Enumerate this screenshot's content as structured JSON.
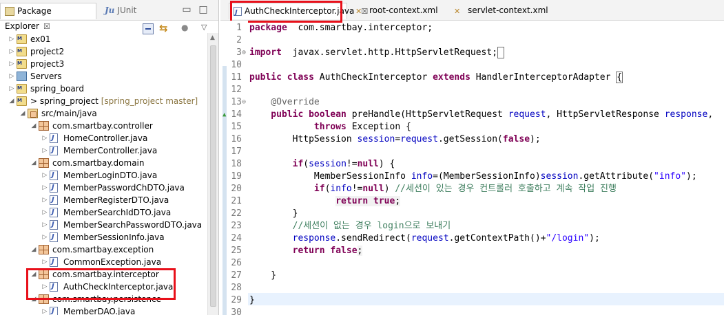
{
  "left_panel": {
    "tabs": [
      {
        "label": "Package Explorer",
        "close": "☒"
      },
      {
        "label": "JUnit",
        "icon_text": "Ju"
      }
    ],
    "tree": [
      {
        "label": "ex01",
        "suffix": "",
        "type": "project",
        "expanded": false
      },
      {
        "label": "project2",
        "suffix": "",
        "type": "project",
        "expanded": false
      },
      {
        "label": "project3",
        "suffix": "",
        "type": "project",
        "expanded": false
      },
      {
        "label": "Servers",
        "suffix": "",
        "type": "server-folder",
        "expanded": false
      },
      {
        "label": "spring_board",
        "suffix": "",
        "type": "project",
        "expanded": false
      },
      {
        "label": "> spring_project",
        "suffix": " [spring_project master]",
        "type": "project",
        "expanded": true
      },
      {
        "label": "src/main/java",
        "suffix": "",
        "type": "source-folder",
        "expanded": true
      },
      {
        "label": "com.smartbay.controller",
        "suffix": "",
        "type": "package",
        "expanded": true
      },
      {
        "label": "HomeController.java",
        "suffix": "",
        "type": "java-file",
        "expanded": false
      },
      {
        "label": "MemberController.java",
        "suffix": "",
        "type": "java-file",
        "expanded": false
      },
      {
        "label": "com.smartbay.domain",
        "suffix": "",
        "type": "package",
        "expanded": true
      },
      {
        "label": "MemberLoginDTO.java",
        "suffix": "",
        "type": "java-file",
        "expanded": false
      },
      {
        "label": "MemberPasswordChDTO.java",
        "suffix": "",
        "type": "java-file",
        "expanded": false
      },
      {
        "label": "MemberRegisterDTO.java",
        "suffix": "",
        "type": "java-file",
        "expanded": false
      },
      {
        "label": "MemberSearchIdDTO.java",
        "suffix": "",
        "type": "java-file",
        "expanded": false
      },
      {
        "label": "MemberSearchPasswordDTO.java",
        "suffix": "",
        "type": "java-file",
        "expanded": false
      },
      {
        "label": "MemberSessionInfo.java",
        "suffix": "",
        "type": "java-file",
        "expanded": false
      },
      {
        "label": "com.smartbay.exception",
        "suffix": "",
        "type": "package",
        "expanded": true
      },
      {
        "label": "CommonException.java",
        "suffix": "",
        "type": "java-file",
        "expanded": false
      },
      {
        "label": "com.smartbay.interceptor",
        "suffix": "",
        "type": "package",
        "expanded": true
      },
      {
        "label": "AuthCheckInterceptor.java",
        "suffix": "",
        "type": "java-file",
        "expanded": false
      },
      {
        "label": "com.smartbay.persistence",
        "suffix": "",
        "type": "package",
        "expanded": true
      },
      {
        "label": "MemberDAO.java",
        "suffix": "",
        "type": "java-file",
        "expanded": false
      }
    ]
  },
  "editor": {
    "tabs": [
      {
        "label": "AuthCheckInterceptor.java",
        "active": true,
        "close": "☒"
      },
      {
        "label": "root-context.xml",
        "active": false
      },
      {
        "label": "servlet-context.xml",
        "active": false
      }
    ],
    "lines": [
      {
        "n": "1",
        "parts": [
          [
            "kw",
            "package"
          ],
          [
            "",
            "  com.smartbay.interceptor;"
          ]
        ]
      },
      {
        "n": "2",
        "parts": []
      },
      {
        "n": "3⊕",
        "parts": [
          [
            "kw",
            "import"
          ],
          [
            "",
            "  javax.servlet.http.HttpServletRequest;"
          ],
          [
            "box",
            "⁠ ⁠"
          ]
        ]
      },
      {
        "n": "10",
        "parts": []
      },
      {
        "n": "11",
        "parts": [
          [
            "kw",
            "public class"
          ],
          [
            "",
            " AuthCheckInterceptor "
          ],
          [
            "kw",
            "extends"
          ],
          [
            "",
            " HandlerInterceptorAdapter "
          ],
          [
            "box",
            "{"
          ]
        ]
      },
      {
        "n": "12",
        "parts": []
      },
      {
        "n": "13⊖",
        "parts": [
          [
            "",
            ""
          ],
          [
            "ann",
            "    @Override"
          ]
        ]
      },
      {
        "n": "14",
        "parts": [
          [
            "kw",
            "    public boolean"
          ],
          [
            "",
            " preHandle(HttpServletRequest "
          ],
          [
            "fld",
            "request"
          ],
          [
            "",
            ", HttpServletResponse "
          ],
          [
            "fld",
            "response"
          ],
          [
            "",
            ","
          ]
        ]
      },
      {
        "n": "15",
        "parts": [
          [
            "",
            "            "
          ],
          [
            "kw",
            "throws"
          ],
          [
            "",
            " Exception {"
          ]
        ]
      },
      {
        "n": "16",
        "parts": [
          [
            "",
            "        HttpSession "
          ],
          [
            "fld",
            "session"
          ],
          [
            "",
            "="
          ],
          [
            "fld",
            "request"
          ],
          [
            "",
            ".getSession("
          ],
          [
            "kw",
            "false"
          ],
          [
            "",
            ");"
          ]
        ]
      },
      {
        "n": "17",
        "parts": []
      },
      {
        "n": "18",
        "parts": [
          [
            "kw",
            "        if"
          ],
          [
            "",
            "("
          ],
          [
            "fld",
            "session"
          ],
          [
            "",
            "!="
          ],
          [
            "kw",
            "null"
          ],
          [
            "",
            ") {"
          ]
        ]
      },
      {
        "n": "19",
        "parts": [
          [
            "",
            "            MemberSessionInfo "
          ],
          [
            "fld",
            "info"
          ],
          [
            "",
            "=(MemberSessionInfo)"
          ],
          [
            "fld",
            "session"
          ],
          [
            "",
            ".getAttribute("
          ],
          [
            "str",
            "\"info\""
          ],
          [
            "",
            ");"
          ]
        ]
      },
      {
        "n": "20",
        "parts": [
          [
            "kw",
            "            if"
          ],
          [
            "",
            "("
          ],
          [
            "fld",
            "info"
          ],
          [
            "",
            "!="
          ],
          [
            "kw",
            "null"
          ],
          [
            "",
            ") "
          ],
          [
            "cm",
            "//세션이 있는 경우 컨트롤러 호출하고 계속 작업 진행"
          ]
        ]
      },
      {
        "n": "21",
        "parts": [
          [
            "",
            "                "
          ],
          [
            "kwm",
            "return true"
          ],
          [
            "mth",
            ";"
          ]
        ]
      },
      {
        "n": "22",
        "parts": [
          [
            "",
            "        }"
          ]
        ]
      },
      {
        "n": "23",
        "parts": [
          [
            "cm",
            "        //세션이 없는 경우 login으로 보내기"
          ]
        ]
      },
      {
        "n": "24",
        "parts": [
          [
            "fld",
            "        response"
          ],
          [
            "",
            ".sendRedirect("
          ],
          [
            "fld",
            "request"
          ],
          [
            "",
            ".getContextPath()+"
          ],
          [
            "str",
            "\"/login\""
          ],
          [
            "",
            ");"
          ]
        ]
      },
      {
        "n": "25",
        "parts": [
          [
            "kw",
            "        return false"
          ],
          [
            "mth",
            ";"
          ]
        ]
      },
      {
        "n": "26",
        "parts": []
      },
      {
        "n": "27",
        "parts": [
          [
            "",
            "    }"
          ]
        ]
      },
      {
        "n": "28",
        "parts": []
      },
      {
        "n": "29",
        "parts": [
          [
            "",
            "}"
          ]
        ]
      },
      {
        "n": "30",
        "parts": []
      }
    ]
  }
}
